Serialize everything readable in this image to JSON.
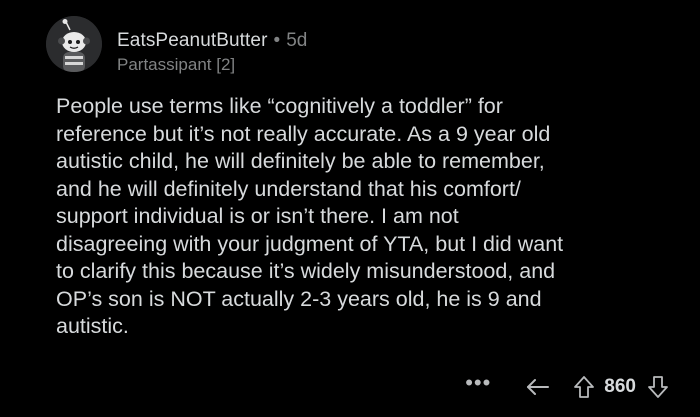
{
  "comment": {
    "author": "EatsPeanutButter",
    "separator": "•",
    "age": "5d",
    "flair": "Partassipant [2]",
    "body_lines": [
      "People use terms like “cognitively a toddler” for",
      "reference but it’s not really accurate. As a 9 year old",
      "autistic child, he will definitely be able to remember,",
      "and he will definitely understand that his comfort/",
      "support individual is or isn’t there. I am not",
      "disagreeing with your judgment of YTA, but I did want",
      "to clarify this because it’s widely misunderstood, and",
      "OP’s son is NOT actually 2-3 years old, he is 9 and",
      "autistic."
    ]
  },
  "actions": {
    "more_label": "•••",
    "score": "860",
    "icons": [
      "more-icon",
      "reply-icon",
      "upvote-icon",
      "downvote-icon"
    ]
  },
  "colors": {
    "background": "#000000",
    "text": "#d7dadc",
    "muted": "#818384"
  }
}
